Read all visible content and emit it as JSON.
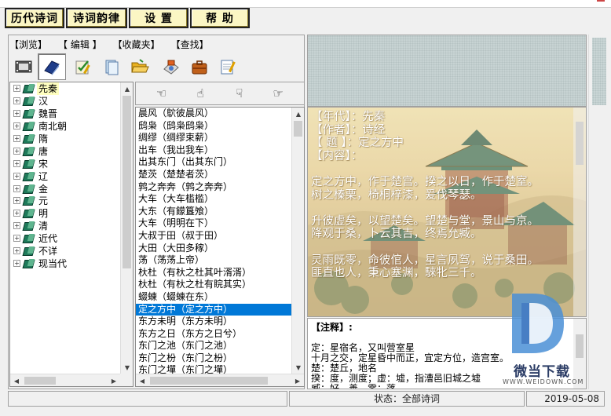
{
  "menu": [
    "历代诗词",
    "诗词韵律",
    "设 置",
    "帮 助"
  ],
  "subtabs": [
    "【浏览】",
    "【 编辑 】",
    "【收藏夹】",
    "【查找】"
  ],
  "toolbar_icons": [
    "film-icon",
    "books-icon",
    "edit-check-icon",
    "files-icon",
    "folder-open-icon",
    "tools-icon",
    "briefcase-icon",
    "notepad-icon"
  ],
  "dynasty_tree": [
    "先秦",
    "汉",
    "魏晋",
    "南北朝",
    "隋",
    "唐",
    "宋",
    "辽",
    "金",
    "元",
    "明",
    "清",
    "近代",
    "不详",
    "现当代"
  ],
  "selected_dynasty": "先秦",
  "nav_icons": [
    "hand-left-icon",
    "hand-up-icon",
    "hand-down-icon",
    "hand-right-icon"
  ],
  "poem_list": [
    "晨风（鴥彼晨风）",
    "鸱枭（鸱枭鸱枭）",
    "绸缪（绸缪束薪）",
    "出车（我出我车）",
    "出其东门（出其东门）",
    "楚茨（楚楚者茨）",
    "鹑之奔奔（鹑之奔奔）",
    "大车（大车槛槛）",
    "大东（有饛簋飧）",
    "大车（明明在下）",
    "大叔于田（叔于田）",
    "大田（大田多稼）",
    "荡（荡荡上帝）",
    "杕杜（有杕之杜其叶湑湑）",
    "杕杜（有杕之杜有睆其实）",
    "蝃蝀（蝃蝀在东）",
    "定之方中（定之方中）",
    "东方未明（东方未明）",
    "东方之日（东方之日兮）",
    "东门之池（东门之池）",
    "东门之枌（东门之枌）",
    "东门之墠（东门之墠）"
  ],
  "selected_poem": "定之方中（定之方中）",
  "poem": {
    "era_line": "【年代】：先秦",
    "author_line": "【作者】：诗经",
    "title_line": "【 题 】：定之方中",
    "content_label": "【内容】：",
    "lines": [
      "定之方中，作于楚宫。揆之以日，作于楚室。",
      "树之榛栗，椅桐梓漆，爰伐琴瑟。",
      "",
      "升彼虚矣，以望楚矣。望楚与堂，景山与京。",
      "降观于桑，卜云其吉，终焉允臧。",
      "",
      "灵雨既零，命彼倌人，星言夙驾，说于桑田。",
      "匪直也人，秉心塞渊，騋牝三千。"
    ]
  },
  "notes": {
    "title": "【注释】:",
    "lines": [
      "",
      "定：星宿名，又叫营室星",
      "十月之交，定星昏中而正，宜定方位，造宫室。",
      "楚：楚丘，地名",
      "揆：度，测度；虚：墟，指漕邑旧城之墟",
      "臧：好、善。零：落"
    ]
  },
  "watermark": {
    "title": "微当下载",
    "url": "WWW.WEIDOWN.COM"
  },
  "status": {
    "left": "",
    "center": "状态：全部诗词",
    "date": "2019-05-08"
  }
}
